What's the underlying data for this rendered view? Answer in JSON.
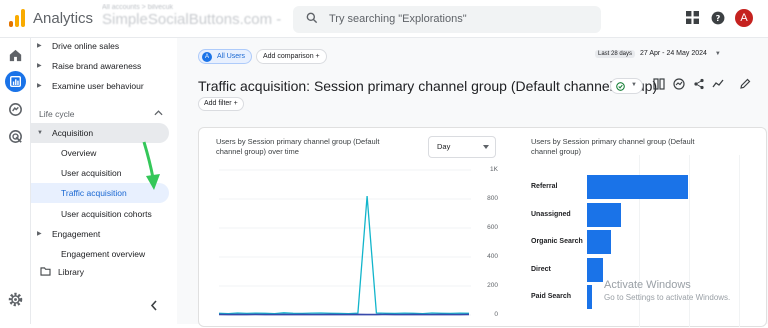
{
  "header": {
    "app_title": "Analytics",
    "account_small": "All accounts > bilvecuk",
    "account_name": "SimpleSocialButtons.com - ...",
    "search_placeholder": "Try searching \"Explorations\"",
    "avatar_letter": "A"
  },
  "icons": [
    "analytics-logo",
    "search-icon",
    "apps-grid-icon",
    "help-icon",
    "home-icon",
    "reports-icon",
    "explore-icon",
    "advertising-icon",
    "settings-icon",
    "collapse-chevron-icon"
  ],
  "nav": {
    "top_items": [
      {
        "label": "Drive online sales"
      },
      {
        "label": "Raise brand awareness"
      },
      {
        "label": "Examine user behaviour"
      }
    ],
    "section": "Life cycle",
    "acquisition": "Acquisition",
    "acquisition_items": [
      {
        "label": "Overview",
        "selected": false
      },
      {
        "label": "User acquisition",
        "selected": false
      },
      {
        "label": "Traffic acquisition",
        "selected": true
      },
      {
        "label": "User acquisition cohorts",
        "selected": false
      }
    ],
    "engagement": "Engagement",
    "engagement_items": [
      {
        "label": "Engagement overview"
      }
    ],
    "library": "Library"
  },
  "toolbar": {
    "all_users": "All Users",
    "add_comparison": "Add comparison",
    "date_pill": "Last 28 days",
    "date_range": "27 Apr - 24 May 2024",
    "title": "Traffic acquisition: Session primary channel group (Default channel group)",
    "add_filter": "Add filter"
  },
  "line_chart": {
    "title": "Users by Session primary channel group (Default channel group) over time",
    "granularity": "Day"
  },
  "bar_chart": {
    "title": "Users by Session primary channel group (Default channel group)"
  },
  "watermark": {
    "line1": "Activate Windows",
    "line2": "Go to Settings to activate Windows."
  },
  "colors": {
    "accent": "#1a73e8",
    "line_secondary": "#7b1fa2",
    "status_ok": "#188038"
  },
  "chart_data": [
    {
      "type": "line",
      "title": "Users by Session primary channel group (Default channel group) over time",
      "y_ticks": [
        "1K",
        "800",
        "600",
        "400",
        "200",
        "0"
      ],
      "ylim": [
        0,
        1000
      ],
      "series": [
        {
          "values": [
            12,
            10,
            14,
            11,
            13,
            12,
            10,
            15,
            12,
            11,
            13,
            14,
            12,
            11,
            10,
            13,
            820,
            14,
            12,
            11,
            13,
            12,
            10,
            14,
            12,
            11,
            13,
            12
          ]
        },
        {
          "values": [
            4,
            3,
            4,
            3,
            4,
            3,
            3,
            4,
            3,
            4,
            3,
            3,
            4,
            3,
            3,
            4,
            3,
            3,
            4,
            3,
            3,
            4,
            3,
            3,
            4,
            3,
            3,
            4
          ]
        }
      ]
    },
    {
      "type": "bar",
      "title": "Users by Session primary channel group (Default channel group)",
      "categories": [
        "Referral",
        "Unassigned",
        "Organic Search",
        "Direct",
        "Paid Search"
      ],
      "values": [
        1000,
        340,
        240,
        160,
        50
      ]
    }
  ]
}
